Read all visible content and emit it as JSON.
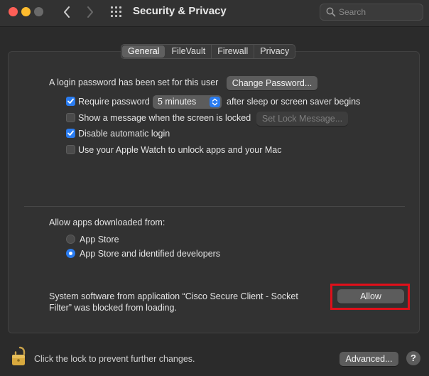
{
  "window": {
    "title": "Security & Privacy"
  },
  "search": {
    "placeholder": "Search"
  },
  "tabs": [
    {
      "label": "General",
      "active": true
    },
    {
      "label": "FileVault",
      "active": false
    },
    {
      "label": "Firewall",
      "active": false
    },
    {
      "label": "Privacy",
      "active": false
    }
  ],
  "general": {
    "login_password_text": "A login password has been set for this user",
    "change_password_label": "Change Password...",
    "require_password": {
      "label": "Require password",
      "checked": true
    },
    "require_password_delay": "5 minutes",
    "after_sleep_text": "after sleep or screen saver begins",
    "show_message": {
      "label": "Show a message when the screen is locked",
      "checked": false
    },
    "set_lock_message_label": "Set Lock Message...",
    "disable_auto_login": {
      "label": "Disable automatic login",
      "checked": true
    },
    "apple_watch": {
      "label": "Use your Apple Watch to unlock apps and your Mac",
      "checked": false
    },
    "allow_apps_heading": "Allow apps downloaded from:",
    "allow_options": [
      {
        "label": "App Store",
        "selected": false
      },
      {
        "label": "App Store and identified developers",
        "selected": true
      }
    ],
    "blocked_line1": "System software from application “Cisco Secure Client - Socket",
    "blocked_line2": "Filter” was blocked from loading.",
    "allow_label": "Allow"
  },
  "footer": {
    "lock_text": "Click the lock to prevent further changes.",
    "advanced_label": "Advanced...",
    "help_label": "?"
  },
  "colors": {
    "accent": "#2a7cf0",
    "highlight": "#e0101a"
  }
}
